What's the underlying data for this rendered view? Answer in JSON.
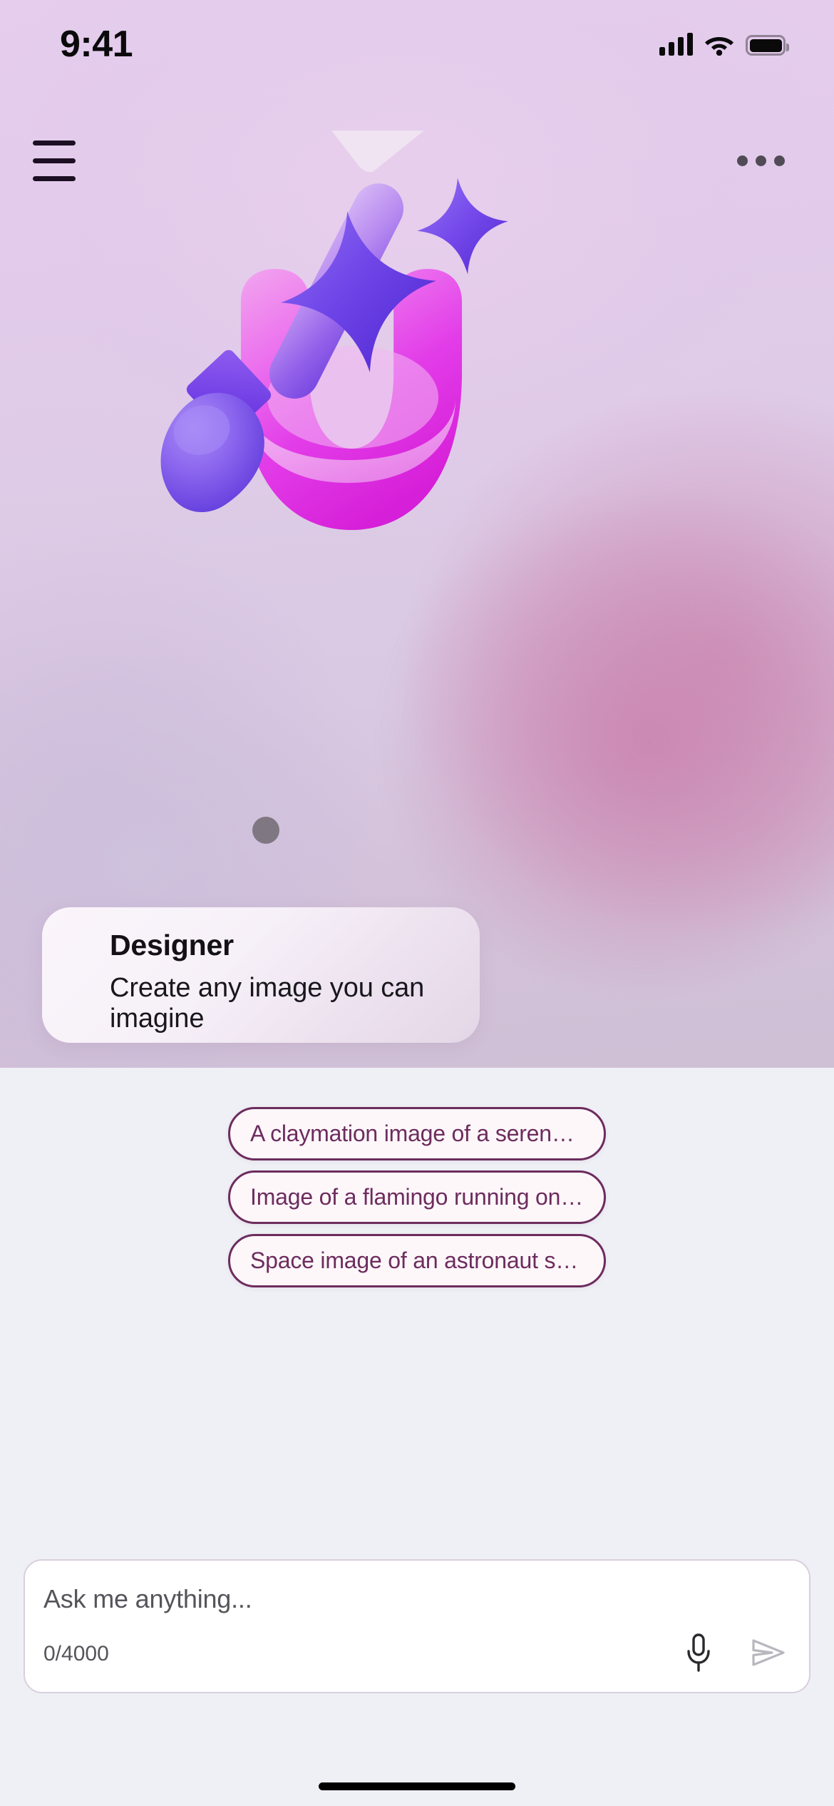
{
  "status_bar": {
    "time": "9:41",
    "cellular_icon": "cellular-bars-icon",
    "wifi_icon": "wifi-icon",
    "battery_icon": "battery-full-icon"
  },
  "top_nav": {
    "menu_icon": "hamburger-menu-icon",
    "more_icon": "more-options-icon"
  },
  "hero": {
    "illustration_name": "designer-paintbrush-illustration",
    "colors": {
      "brush_handle_light": "#c8a5f0",
      "brush_handle_dark": "#7b4ee0",
      "ferrule": "#6f42e0",
      "bristle_tip": "#6a4ae8",
      "sparkle": "#5b3fd6",
      "swoosh_magenta": "#dc2ae0",
      "swoosh_pink": "#f0a0ec",
      "background_lavender": "#e2cbea",
      "background_mauve": "#cfb6cd"
    }
  },
  "designer_card": {
    "title": "Designer",
    "subtitle": "Create any image you can imagine"
  },
  "suggestions": {
    "items": [
      {
        "label": "A claymation image of a serene colorful lake at sunset"
      },
      {
        "label": "Image of a flamingo running on the street in a business suit"
      },
      {
        "label": "Space image of an astronaut skiing on the moon surface"
      }
    ],
    "accent_color": "#6d2c5e"
  },
  "composer": {
    "placeholder": "Ask me anything...",
    "value": "",
    "counter": "0/4000",
    "mic_icon": "microphone-icon",
    "send_icon": "send-icon"
  },
  "system": {
    "home_indicator": "home-indicator"
  }
}
